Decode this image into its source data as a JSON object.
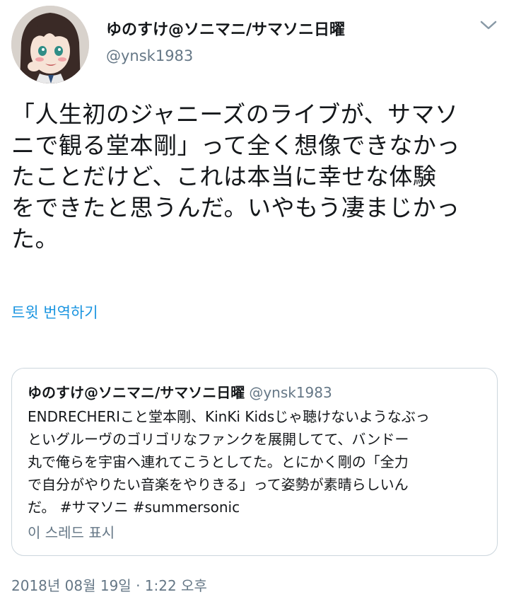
{
  "tweet": {
    "author": {
      "display_name": "ゆのすけ@ソニマニ/サマソニ日曜",
      "handle": "@ynsk1983"
    },
    "text_lines": [
      "「人生初のジャニーズのライブが、サマソ",
      "ニで観る堂本剛」って全く想像できなかっ",
      "たことだけど、これは本当に幸せな体験",
      "をできたと思うんだ。いやもう凄まじかっ",
      "た。"
    ],
    "translate_label": "트윗 번역하기",
    "timestamp": "2018년 08월 19일 · 1:22 오후"
  },
  "quoted_tweet": {
    "display_name": "ゆのすけ@ソニマニ/サマソニ日曜",
    "handle": "@ynsk1983",
    "text_lines": [
      "ENDRECHERIこと堂本剛、KinKi Kidsじゃ聴けないようなぶっ",
      "といグルーヴのゴリゴリなファンクを展開してて、バンドー",
      "丸で俺らを宇宙へ連れてこうとしてた。とにかく剛の「全力",
      "で自分がやりたい音楽をやりきる」って姿勢が素晴らしいん",
      "だ。 #サマソニ #summersonic"
    ],
    "show_thread_label": "이 스레드 표시"
  },
  "colors": {
    "text_primary": "#14171a",
    "text_secondary": "#657786",
    "link": "#1b95e0",
    "border": "#ccd6dd"
  },
  "icons": {
    "menu": "chevron-down-icon"
  }
}
